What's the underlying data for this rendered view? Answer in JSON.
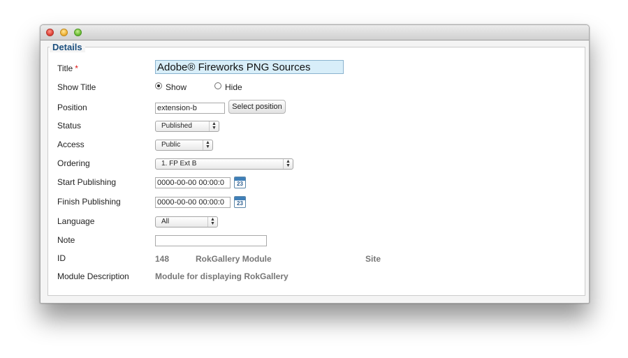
{
  "window": {
    "controls": [
      "close",
      "minimize",
      "zoom"
    ]
  },
  "legend": "Details",
  "fields": {
    "title": {
      "label": "Title",
      "required_mark": "*",
      "value": "Adobe® Fireworks PNG Sources"
    },
    "show_title": {
      "label": "Show Title",
      "options": [
        "Show",
        "Hide"
      ],
      "selected": "Show"
    },
    "position": {
      "label": "Position",
      "value": "extension-b",
      "button": "Select position"
    },
    "status": {
      "label": "Status",
      "value": "Published"
    },
    "access": {
      "label": "Access",
      "value": "Public"
    },
    "ordering": {
      "label": "Ordering",
      "value": "1. FP Ext B"
    },
    "start_publishing": {
      "label": "Start Publishing",
      "value": "0000-00-00 00:00:0",
      "calendar_num": "23"
    },
    "finish_publishing": {
      "label": "Finish Publishing",
      "value": "0000-00-00 00:00:0",
      "calendar_num": "23"
    },
    "language": {
      "label": "Language",
      "value": "All"
    },
    "note": {
      "label": "Note",
      "value": ""
    },
    "id": {
      "label": "ID",
      "value": "148",
      "module": "RokGallery Module",
      "client": "Site"
    },
    "description": {
      "label": "Module Description",
      "value": "Module for displaying RokGallery"
    }
  },
  "colors": {
    "legend": "#1c4f7e",
    "title_input_bg": "#d8eef9",
    "required": "#dd1111",
    "calendar": "#3f7fb8"
  },
  "icons": {
    "calendar": "calendar-icon"
  }
}
